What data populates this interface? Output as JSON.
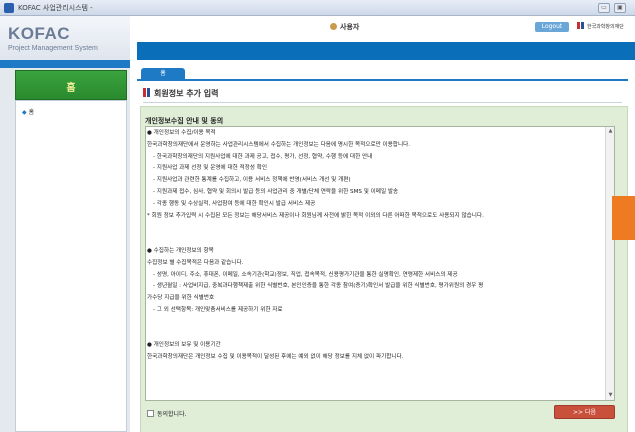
{
  "window": {
    "title": "KOFAC 사업관리시스템 -",
    "min_glyph": "▭",
    "max_glyph": "▣"
  },
  "header": {
    "logo": "KOFAC",
    "logo_sub": "Project Management System",
    "user_label": "사용자",
    "logout_label": "Logout",
    "org_name": "한국과학창의재단"
  },
  "sidebar": {
    "home_label": "홈",
    "items": [
      {
        "label": "홈"
      }
    ]
  },
  "main": {
    "tab_label": "홈",
    "page_title": "회원정보 추가 입력",
    "section_title": "개인정보수집 안내 및 동의",
    "content_lines": [
      "● 개인정보의 수집/이용 목적",
      "한국과학창의재단에서 운영하는 사업관리시스템에서 수집하는 개인정보는 다음에 명시한 목적으로만 이용합니다.",
      "- 한국과학창의재단의 지원사업에 대한 과제 공고, 접수, 평가, 선정, 협약, 수행 등에 대한 안내",
      "- 지원사업 과제 선정 및 운영에 대한 적정성 확인",
      "- 지원사업과 관련한 통계를 수집하고, 이용 서비스 정책에 반영(서비스 개선 및 개편)",
      "- 지원과제 접수, 심사, 협약 및 회의시 발급 등의 사업관리 중 개별/단체 연락을 위한 SMS 및 이메일 발송",
      "- 각종 행동 및 수상실적, 사업참여 등에 대한 확인시 발급 서비스 제공",
      "* 회원 정보 추가입력 시 수집된 모든 정보는 해당서비스 제공이나 회원님께 사전에 밝힌 목적 이외의 다른 어떠한 목적으로도 사용되지 않습니다.",
      "",
      "",
      "● 수집하는 개인정보의 항목",
      "수집정보 별 수집목적은 다음과 같습니다.",
      "- 성명, 아이디, 주소, 휴대폰, 이메일, 소속기관(학교)정보, 직업, 접속목적, 신용평가기관을 통한 실명확인, 연령제한 서비스의 제공",
      "- 생년월일 : 사업비지급, 중복과다행책제출 위한 식별번호, 본인인증을 통한 각종 참여(증기)확인서 발급을 위한 식별번호, 평가위원의 경우 평",
      "가수당 지급을 위한 식별번호",
      "- 그 외 선택항목: 개인맞춤서비스를 제공하기 위한 자료",
      "",
      "",
      "● 개인정보의 보유 및 이용기간",
      "한국과학창의재단은 개인정보 수집 및 이용목적이 달성된 후에는 예외 없이 해당 정보를 지체 없이 파기합니다."
    ],
    "agree_label": "동의합니다.",
    "next_label": ">> 다음"
  },
  "colors": {
    "accent_blue": "#0a6fb8",
    "home_green": "#2a8a2e",
    "agree_panel": "#e0eed8",
    "next_button": "#c9503a",
    "side_tab": "#ee7a22"
  }
}
